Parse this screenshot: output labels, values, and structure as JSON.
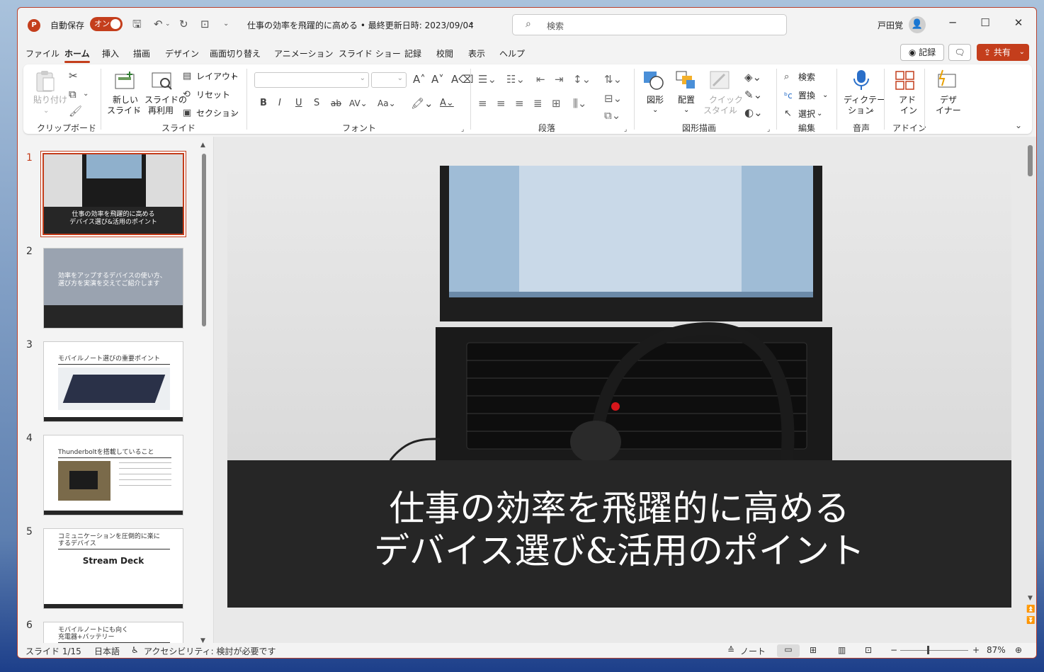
{
  "title": {
    "autosave_label": "自動保存",
    "autosave_state": "オン",
    "doc_title": "仕事の効率を飛躍的に高める • 最終更新日時: 2023/09/04",
    "search_placeholder": "検索",
    "user_name": "戸田覚"
  },
  "tabs": [
    "ファイル",
    "ホーム",
    "挿入",
    "描画",
    "デザイン",
    "画面切り替え",
    "アニメーション",
    "スライド ショー",
    "記録",
    "校閲",
    "表示",
    "ヘルプ"
  ],
  "actions": {
    "record": "記録",
    "share": "共有"
  },
  "ribbon": {
    "clipboard": {
      "paste": "貼り付け",
      "label": "クリップボード"
    },
    "slides": {
      "new_slide_1": "新しい",
      "new_slide_2": "スライド",
      "reuse_1": "スライドの",
      "reuse_2": "再利用",
      "layout": "レイアウト",
      "reset": "リセット",
      "section": "セクション",
      "label": "スライド"
    },
    "font": {
      "label": "フォント"
    },
    "paragraph": {
      "label": "段落"
    },
    "drawing": {
      "shapes": "図形",
      "arrange": "配置",
      "quick_1": "クイック",
      "quick_2": "スタイル",
      "label": "図形描画"
    },
    "editing": {
      "find": "検索",
      "replace": "置換",
      "select": "選択",
      "label": "編集"
    },
    "voice": {
      "dictate_1": "ディクテー",
      "dictate_2": "ション",
      "label": "音声"
    },
    "addins": {
      "addin_1": "アド",
      "addin_2": "イン",
      "label": "アドイン"
    },
    "designer": {
      "d1": "デザ",
      "d2": "イナー"
    }
  },
  "thumbnails": [
    {
      "num": "1",
      "line1": "仕事の効率を飛躍的に高める",
      "line2": "デバイス選び&活用のポイント"
    },
    {
      "num": "2",
      "line1": "効率をアップするデバイスの使い方、",
      "line2": "選び方を実演を交えてご紹介します"
    },
    {
      "num": "3",
      "line1": "モバイルノート選びの重要ポイント"
    },
    {
      "num": "4",
      "line1": "Thunderboltを搭載していること"
    },
    {
      "num": "5",
      "line1": "コミュニケーションを圧倒的に楽に",
      "line2": "するデバイス",
      "line3": "Stream Deck"
    },
    {
      "num": "6",
      "line1": "モバイルノートにも向く",
      "line2": "充電器+バッテリー"
    }
  ],
  "slide": {
    "line1": "仕事の効率を飛躍的に高める",
    "line2": "デバイス選び&活用のポイント"
  },
  "status": {
    "slide_info": "スライド 1/15",
    "language": "日本語",
    "accessibility": "アクセシビリティ: 検討が必要です",
    "notes": "ノート",
    "zoom": "87%"
  }
}
